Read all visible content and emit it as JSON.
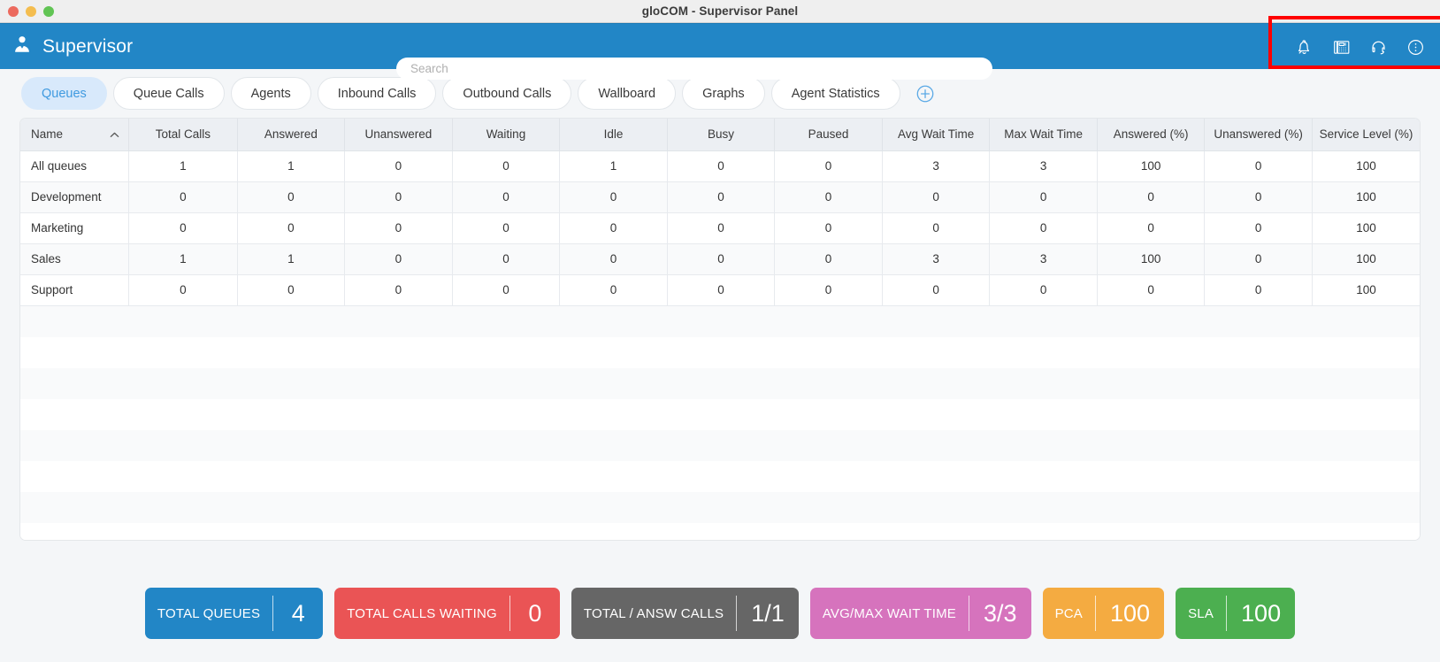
{
  "window": {
    "title": "gloCOM - Supervisor Panel",
    "controls": [
      "close-button",
      "minimize-button",
      "maximize-button"
    ]
  },
  "header": {
    "brand_label": "Supervisor",
    "brand_icon": "user-icon",
    "search": {
      "placeholder": "Search",
      "value": ""
    },
    "actions": [
      {
        "name": "notifications-icon",
        "label": "Notifications"
      },
      {
        "name": "phone-icon",
        "label": "Phone"
      },
      {
        "name": "headset-icon",
        "label": "Headset"
      },
      {
        "name": "more-options-icon",
        "label": "More options"
      }
    ],
    "highlight_color": "#ff0000",
    "bg_color": "#2286c6"
  },
  "tabs": {
    "items": [
      {
        "label": "Queues",
        "active": true
      },
      {
        "label": "Queue Calls",
        "active": false
      },
      {
        "label": "Agents",
        "active": false
      },
      {
        "label": "Inbound Calls",
        "active": false
      },
      {
        "label": "Outbound Calls",
        "active": false
      },
      {
        "label": "Wallboard",
        "active": false
      },
      {
        "label": "Graphs",
        "active": false
      },
      {
        "label": "Agent Statistics",
        "active": false
      }
    ],
    "add_tab_icon": "plus-circle-icon",
    "active_color": "#3f9ae0"
  },
  "table": {
    "sort_column": "Name",
    "sort_direction": "ascending",
    "columns": [
      "Name",
      "Total Calls",
      "Answered",
      "Unanswered",
      "Waiting",
      "Idle",
      "Busy",
      "Paused",
      "Avg Wait Time",
      "Max Wait Time",
      "Answered (%)",
      "Unanswered (%)",
      "Service Level (%)"
    ],
    "rows": [
      [
        "All queues",
        "1",
        "1",
        "0",
        "0",
        "1",
        "0",
        "0",
        "3",
        "3",
        "100",
        "0",
        "100"
      ],
      [
        "Development",
        "0",
        "0",
        "0",
        "0",
        "0",
        "0",
        "0",
        "0",
        "0",
        "0",
        "0",
        "100"
      ],
      [
        "Marketing",
        "0",
        "0",
        "0",
        "0",
        "0",
        "0",
        "0",
        "0",
        "0",
        "0",
        "0",
        "100"
      ],
      [
        "Sales",
        "1",
        "1",
        "0",
        "0",
        "0",
        "0",
        "0",
        "3",
        "3",
        "100",
        "0",
        "100"
      ],
      [
        "Support",
        "0",
        "0",
        "0",
        "0",
        "0",
        "0",
        "0",
        "0",
        "0",
        "0",
        "0",
        "100"
      ]
    ]
  },
  "stats": [
    {
      "label": "TOTAL QUEUES",
      "value": "4",
      "color": "#2286c6"
    },
    {
      "label": "TOTAL CALLS WAITING",
      "value": "0",
      "color": "#ea5455"
    },
    {
      "label": "TOTAL / ANSW CALLS",
      "value": "1/1",
      "color": "#666666"
    },
    {
      "label": "AVG/MAX WAIT TIME",
      "value": "3/3",
      "color": "#d673bd"
    },
    {
      "label": "PCA",
      "value": "100",
      "color": "#f4ab41"
    },
    {
      "label": "SLA",
      "value": "100",
      "color": "#4caf50"
    }
  ]
}
